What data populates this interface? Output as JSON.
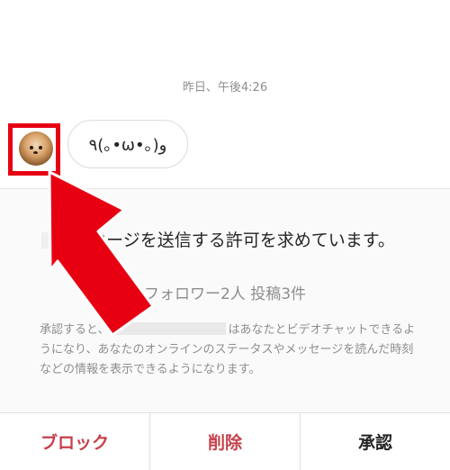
{
  "conversation": {
    "timestamp": "昨日、午後4:26",
    "message": "٩(｡•ω•｡)و"
  },
  "request": {
    "title": "メッセージを送信する許可を求めています。",
    "stats": "フォロワー2人 投稿3件",
    "description_before": "承認すると、",
    "description_after": "はあなたとビデオチャットできるようになり、あなたのオンラインのステータスやメッセージを読んだ時刻などの情報を表示できるようになります。"
  },
  "actions": {
    "block": "ブロック",
    "delete": "削除",
    "accept": "承認"
  },
  "colors": {
    "highlight": "#e60012",
    "destructive": "#c6404c",
    "muted": "#8e8e8e"
  },
  "icons": {
    "avatar": "profile-photo-shiba-dog",
    "annotation": "red-arrow-pointing-to-avatar"
  }
}
